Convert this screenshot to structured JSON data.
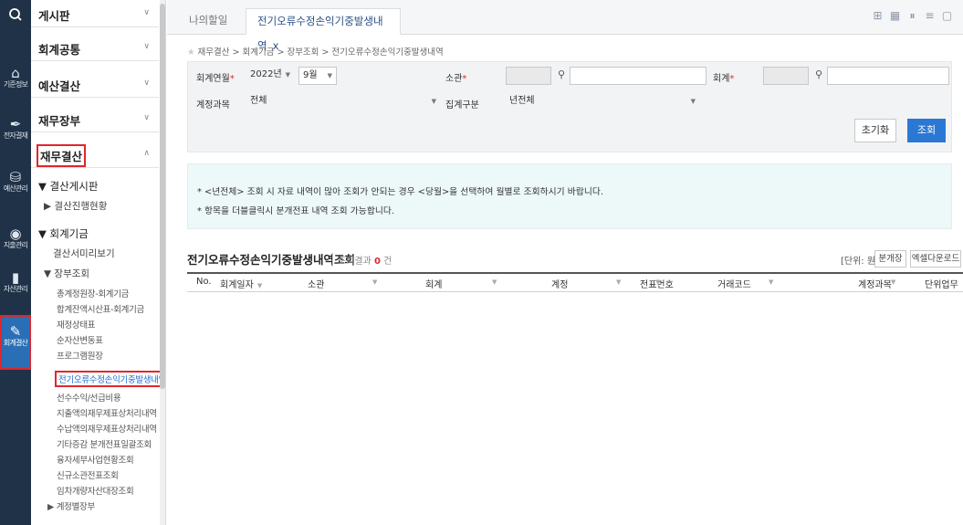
{
  "rail": {
    "search_icon": "search-icon",
    "items": [
      {
        "label": "기준정보",
        "icon": "home-icon"
      },
      {
        "label": "전자결재",
        "icon": "pen-icon"
      },
      {
        "label": "예산관리",
        "icon": "coins-icon"
      },
      {
        "label": "지출관리",
        "icon": "wallet-icon"
      },
      {
        "label": "자산관리",
        "icon": "building-icon"
      },
      {
        "label": "회계결산",
        "icon": "settle-icon",
        "active": true
      }
    ]
  },
  "menu": {
    "categories": [
      "게시판",
      "회계공통",
      "예산결산",
      "재무장부",
      "재무결산"
    ],
    "tree": {
      "board": "▼ 결산게시판",
      "board_status": "▶ 결산진행현황",
      "accounting": "▼ 회계기금",
      "preview": "결산서미리보기",
      "ledger": "▼ 장부조회",
      "items": [
        "총계정원장-회계기금",
        "합계잔액시산표-회계기금",
        "재정상태표",
        "순자산변동표",
        "프로그램원장",
        "전기오류수정손익기중발생내역",
        "선수수익/선급비용",
        "지출액의재무제표상처리내역",
        "수납액의재무제표상처리내역",
        "기타증감 분개전표일괄조회",
        "융자세부사업현황조회",
        "신규소관전표조회",
        "임차개량자산대장조회"
      ],
      "last": "▶ 계정별장부"
    }
  },
  "tabs": {
    "inactive": "나의할일",
    "active": "전기오류수정손익기중발생내역",
    "close": "x"
  },
  "breadcrumb": "재무결산 > 회계기금 > 장부조회 > 전기오류수정손익기중발생내역",
  "search": {
    "fiscal_label": "회계연월",
    "year": "2022년",
    "month": "9월",
    "jurisdiction_label": "소관",
    "account_label": "회계",
    "subject_label": "계정과목",
    "subject_value": "전체",
    "aggregate_label": "집계구분",
    "aggregate_value": "년전체",
    "reset": "초기화",
    "query": "조회"
  },
  "notice": {
    "line1": "* <년전체> 조회 시 자료 내역이 많아 조회가 안되는 경우 <당월>을 선택하여 월별로 조회하시기 바랍니다.",
    "line2": "* 항목을 더블클릭시 분개전표 내역 조회 가능합니다."
  },
  "result": {
    "title": "전기오류수정손익기중발생내역조회",
    "count_label": "조회결과",
    "count": "0",
    "count_unit": "건",
    "unit": "[단위: 원]",
    "split_btn": "분개장",
    "excel_btn": "엑셀다운로드"
  },
  "grid": {
    "columns": [
      "No.",
      "회계일자",
      "소관",
      "회계",
      "계정",
      "전표번호",
      "거래코드",
      "계정과목",
      "단위업무"
    ],
    "filter_mark": "▼"
  }
}
